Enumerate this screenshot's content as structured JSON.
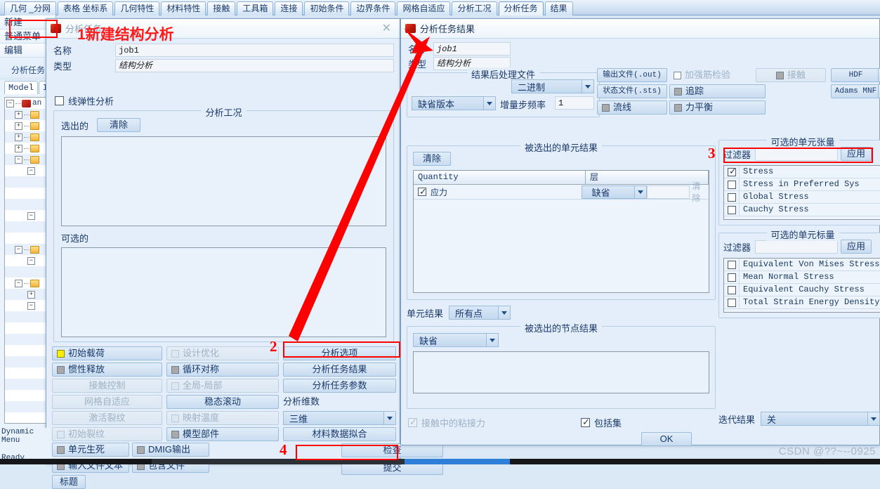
{
  "ribbon": {
    "tabs": [
      {
        "label": "几何 _分网",
        "active": false
      },
      {
        "label": "表格 坐标系",
        "active": false
      },
      {
        "label": "几何特性",
        "active": false
      },
      {
        "label": "材料特性",
        "active": false
      },
      {
        "label": "接触",
        "active": false
      },
      {
        "label": "工具箱",
        "active": false
      },
      {
        "label": "连接",
        "active": false
      },
      {
        "label": "初始条件",
        "active": false
      },
      {
        "label": "边界条件",
        "active": false
      },
      {
        "label": "网格自适应",
        "active": false
      },
      {
        "label": "分析工况",
        "active": false
      },
      {
        "label": "分析任务",
        "active": true
      },
      {
        "label": "结果",
        "active": false
      }
    ]
  },
  "command_column": {
    "items": [
      "新建",
      "普通菜单",
      "编辑"
    ],
    "group_label": "分析任务"
  },
  "tree_panel": {
    "tabs": [
      {
        "label": "Model",
        "active": true
      },
      {
        "label": "I",
        "active": false
      }
    ],
    "root_label": "an"
  },
  "status": {
    "dynamic_menu": "Dynamic Menu",
    "ready": "Ready"
  },
  "watermark": "CSDN @??~--0925",
  "dialog_new_job": {
    "title": "分析任务",
    "close_icon": "close-icon",
    "name_label": "名称",
    "name_value": "job1",
    "type_label": "类型",
    "type_value": "结构分析",
    "linear_elastic_label": "线弹性分析",
    "linear_elastic_checked": false,
    "loadcase_group_title": "分析工况",
    "selected_label": "选出的",
    "clear_button": "清除",
    "available_label": "可选的",
    "buttons_col1": [
      {
        "label": "初始载荷",
        "box": "yellow",
        "disabled": false
      },
      {
        "label": "惯性释放",
        "box": "grey",
        "disabled": false
      },
      {
        "label": "接触控制",
        "box": "none",
        "disabled": true
      },
      {
        "label": "网格自适应",
        "box": "none",
        "disabled": true
      },
      {
        "label": "激活裂纹",
        "box": "none",
        "disabled": true
      },
      {
        "label": "初始裂纹",
        "box": "pale",
        "disabled": true
      }
    ],
    "buttons_col2": [
      {
        "label": "设计优化",
        "box": "pale",
        "disabled": true
      },
      {
        "label": "循环对称",
        "box": "grey",
        "disabled": false
      },
      {
        "label": "全局-局部",
        "box": "pale",
        "disabled": true
      },
      {
        "label": "稳态滚动",
        "box": "none",
        "disabled": false
      },
      {
        "label": "映射温度",
        "box": "pale",
        "disabled": true
      },
      {
        "label": "模型部件",
        "box": "grey",
        "disabled": false
      }
    ],
    "buttons_col3": [
      {
        "label": "分析选项"
      },
      {
        "label": "分析任务结果"
      },
      {
        "label": "分析任务参数"
      }
    ],
    "dimension_label": "分析维数",
    "dimension_value": "三维",
    "material_fit_button": "材料数据拟合",
    "bottom_toggles": [
      {
        "label": "单元生死",
        "box": "grey"
      },
      {
        "label": "DMIG输出",
        "box": "grey"
      },
      {
        "label": "输入文件文本",
        "box": "grey"
      },
      {
        "label": "包含文件",
        "box": "grey"
      }
    ],
    "title_button": "标题",
    "check_button": "检查",
    "submit_button": "提交"
  },
  "dialog_job_results": {
    "title": "分析任务结果",
    "name_label": "名称",
    "name_value": "job1",
    "type_label": "类型",
    "type_value": "结构分析",
    "post_group_title": "结果后处理文件",
    "format_value": "二进制",
    "version_value": "缺省版本",
    "increment_label": "增量步频率",
    "increment_value": "1",
    "file_buttons": [
      {
        "label": "输出文件(.out)",
        "box": "none",
        "disabled": false
      },
      {
        "label": "状态文件(.sts)",
        "box": "none",
        "disabled": false
      },
      {
        "label": "流线",
        "box": "grey",
        "disabled": false
      }
    ],
    "option_buttons": [
      {
        "label": "加强筋检验",
        "box": "white",
        "disabled": true
      },
      {
        "label": "追踪",
        "box": "grey",
        "disabled": false
      },
      {
        "label": "力平衡",
        "box": "grey",
        "disabled": false
      }
    ],
    "contact_button": {
      "label": "接触",
      "box": "grey",
      "disabled": true
    },
    "export_buttons": [
      "HDF",
      "Adams MNF"
    ],
    "elem_results_group_title": "被选出的单元结果",
    "clear_button": "清除",
    "table_headers": [
      "Quantity",
      "层"
    ],
    "table_rows": [
      {
        "checked": true,
        "quantity": "应力",
        "layer": "缺省",
        "value": "",
        "clear": "清除"
      }
    ],
    "elem_result_label": "单元结果",
    "elem_result_value": "所有点",
    "node_results_group_title": "被选出的节点结果",
    "node_default_value": "缺省",
    "bond_force_label": "接触中的粘接力",
    "bond_force_checked": true,
    "bond_force_disabled": true,
    "include_set_label": "包括集",
    "include_set_checked": true,
    "ok_button": "OK",
    "iteration_label": "迭代结果",
    "iteration_value": "关",
    "tensor_group_title": "可选的单元张量",
    "tensor_filter_label": "过滤器",
    "tensor_filter_value": "",
    "tensor_apply_button": "应用",
    "tensor_items": [
      {
        "label": "Stress",
        "checked": true
      },
      {
        "label": "Stress in Preferred Sys",
        "checked": false
      },
      {
        "label": "Global Stress",
        "checked": false
      },
      {
        "label": "Cauchy Stress",
        "checked": false
      }
    ],
    "scalar_group_title": "可选的单元标量",
    "scalar_filter_label": "过滤器",
    "scalar_filter_value": "",
    "scalar_apply_button": "应用",
    "scalar_items": [
      {
        "label": "Equivalent Von Mises Stress",
        "checked": false
      },
      {
        "label": "Mean Normal Stress",
        "checked": false
      },
      {
        "label": "Equivalent Cauchy Stress",
        "checked": false
      },
      {
        "label": "Total Strain Energy Density",
        "checked": false
      }
    ]
  },
  "annotations": {
    "step1_title": "1新建结构分析",
    "step2": "2",
    "step3": "3",
    "step4": "4",
    "color": "#ff0000"
  }
}
